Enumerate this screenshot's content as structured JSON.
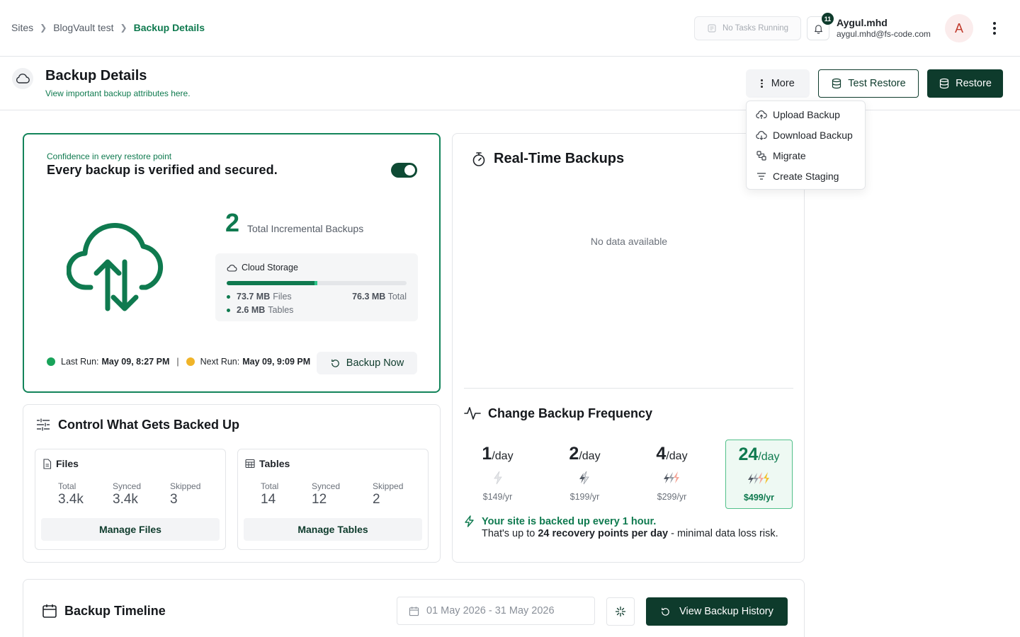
{
  "breadcrumb": {
    "items": [
      "Sites",
      "BlogVault test"
    ],
    "current": "Backup Details"
  },
  "topbar": {
    "tasks_label": "No Tasks Running",
    "notification_count": "11",
    "user_name": "Aygul.mhd",
    "user_email": "aygul.mhd@fs-code.com",
    "avatar_letter": "A"
  },
  "page_header": {
    "title": "Backup Details",
    "subtitle": "View important backup attributes here.",
    "more_label": "More",
    "test_restore_label": "Test Restore",
    "restore_label": "Restore"
  },
  "more_menu": {
    "items": [
      {
        "label": "Upload Backup",
        "icon": "cloud-upload-icon"
      },
      {
        "label": "Download Backup",
        "icon": "cloud-download-icon"
      },
      {
        "label": "Migrate",
        "icon": "migrate-icon"
      },
      {
        "label": "Create Staging",
        "icon": "filter-icon"
      }
    ]
  },
  "verify_card": {
    "kicker": "Confidence in every restore point",
    "title": "Every backup is verified and secured.",
    "toggle_on": true,
    "incremental_count": "2",
    "incremental_label": "Total Incremental Backups",
    "storage": {
      "label": "Cloud Storage",
      "used_fraction": 0.505,
      "files_value": "73.7 MB",
      "files_label": "Files",
      "tables_value": "2.6 MB",
      "tables_label": "Tables",
      "total_value": "76.3 MB",
      "total_label": "Total"
    },
    "last_run_label": "Last Run:",
    "last_run_value": "May 09, 8:27 PM",
    "next_run_label": "Next Run:",
    "next_run_value": "May 09, 9:09 PM",
    "backup_now_label": "Backup Now"
  },
  "control_card": {
    "title": "Control What Gets Backed Up",
    "files": {
      "title": "Files",
      "total_label": "Total",
      "total": "3.4k",
      "synced_label": "Synced",
      "synced": "3.4k",
      "skipped_label": "Skipped",
      "skipped": "3",
      "button": "Manage Files"
    },
    "tables": {
      "title": "Tables",
      "total_label": "Total",
      "total": "14",
      "synced_label": "Synced",
      "synced": "12",
      "skipped_label": "Skipped",
      "skipped": "2",
      "button": "Manage Tables"
    }
  },
  "realtime_card": {
    "title": "Real-Time Backups",
    "empty_text": "No data available",
    "frequency_title": "Change Backup Frequency",
    "options": [
      {
        "count": "1",
        "unit": "/day",
        "price": "$149/yr",
        "selected": false
      },
      {
        "count": "2",
        "unit": "/day",
        "price": "$199/yr",
        "selected": false
      },
      {
        "count": "4",
        "unit": "/day",
        "price": "$299/yr",
        "selected": false
      },
      {
        "count": "24",
        "unit": "/day",
        "price": "$499/yr",
        "selected": true
      }
    ],
    "note_line1": "Your site is backed up every 1 hour.",
    "note_pre": "That's up to ",
    "note_bold": "24 recovery points per day",
    "note_post": " - minimal data loss risk."
  },
  "timeline_card": {
    "title": "Backup Timeline",
    "date_range": "01 May 2026 - 31 May 2026",
    "history_button": "View Backup History"
  },
  "colors": {
    "brand_dark": "#0e3b2c",
    "brand_green": "#0f7a4f",
    "accent": "#2cc488"
  }
}
